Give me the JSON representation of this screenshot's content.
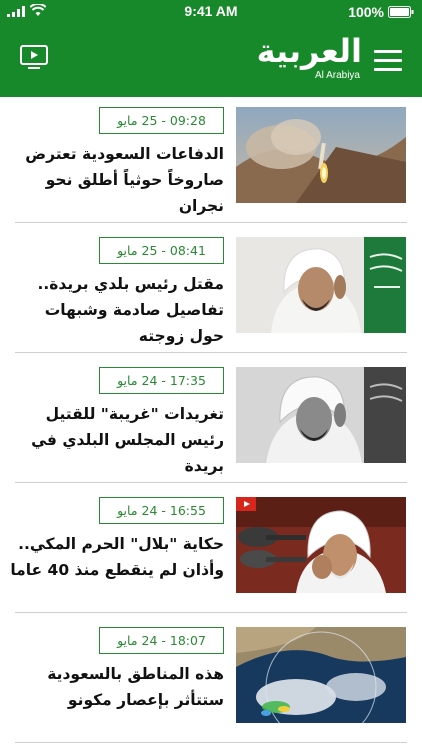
{
  "status_bar": {
    "time": "9:41 AM",
    "battery": "100%"
  },
  "header": {
    "logo_arabic": "العربية",
    "logo_english": "Al Arabiya",
    "accent": "#18892a"
  },
  "articles": [
    {
      "date": "09:28 - 25 مايو",
      "title": "الدفاعات السعودية تعترض صاروخاً حوثياً أطلق نحو نجران",
      "image": "missile-launch-photo",
      "has_video": false
    },
    {
      "date": "08:41 - 25 مايو",
      "title": "مقتل رئيس بلدي بريدة.. تفاصيل صادمة وشبهات حول زوجته",
      "image": "portrait-photo-flag",
      "has_video": false
    },
    {
      "date": "17:35 - 24 مايو",
      "title": "تغريدات \"غريبة\" للقتيل رئيس المجلس البلدي في بريدة",
      "image": "portrait-photo-grayscale",
      "has_video": false
    },
    {
      "date": "16:55 - 24 مايو",
      "title": "حكاية \"بلال\" الحرم المكي.. وأذان لم ينقطع منذ 40 عاما",
      "image": "muezzin-microphone-photo",
      "has_video": true
    },
    {
      "date": "18:07 - 24 مايو",
      "title": "هذه المناطق بالسعودية ستتأثر بإعصار مكونو",
      "image": "satellite-weather-map",
      "has_video": false
    }
  ]
}
